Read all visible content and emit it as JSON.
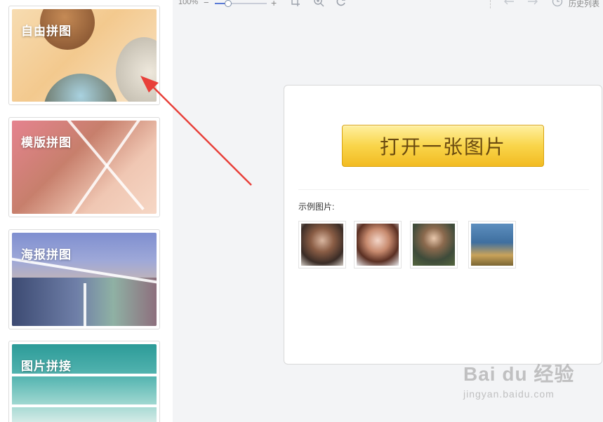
{
  "sidebar": {
    "cards": [
      {
        "label": "自由拼图"
      },
      {
        "label": "模版拼图"
      },
      {
        "label": "海报拼图"
      },
      {
        "label": "图片拼接"
      }
    ]
  },
  "toolbar": {
    "zoom_level": "100%",
    "zoom_minus": "−",
    "zoom_plus": "+",
    "zoom_value": 0.2,
    "history_label": "历史列表",
    "icons": [
      "crop-icon",
      "zoom-in-icon",
      "rotate-icon",
      "undo-icon",
      "redo-icon",
      "clock-icon"
    ]
  },
  "main": {
    "open_button_label": "打开一张图片",
    "example_label": "示例图片:",
    "examples": [
      "example-portrait-1",
      "example-portrait-2",
      "example-child",
      "example-seaside"
    ]
  },
  "annotation": {
    "color": "#e8403a"
  },
  "watermark": {
    "logo": "Bai du 经验",
    "sub": "jingyan.baidu.com"
  }
}
